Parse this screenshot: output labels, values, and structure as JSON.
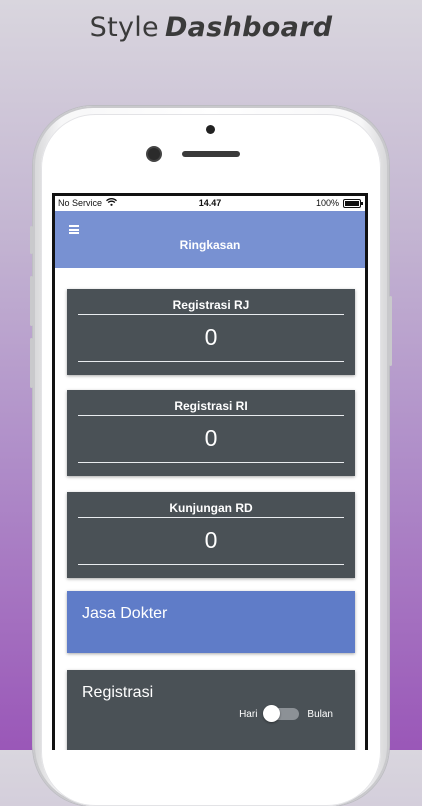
{
  "headline": {
    "light": "Style",
    "bold": "Dashboard"
  },
  "status_bar": {
    "carrier": "No Service",
    "time": "14.47",
    "battery": "100%"
  },
  "header": {
    "title": "Ringkasan"
  },
  "stats": [
    {
      "title": "Registrasi RJ",
      "value": "0"
    },
    {
      "title": "Registrasi RI",
      "value": "0"
    },
    {
      "title": "Kunjungan RD",
      "value": "0"
    }
  ],
  "jasa": {
    "title": "Jasa Dokter"
  },
  "registrasi": {
    "title": "Registrasi",
    "toggle_left": "Hari",
    "toggle_right": "Bulan",
    "toggle_on_right": false
  },
  "colors": {
    "header": "#7891d2",
    "card": "#4a5156",
    "jasa": "#5f7cc8"
  },
  "icons": {
    "menu": "menu-icon",
    "wifi": "wifi-icon",
    "battery": "battery-icon"
  }
}
